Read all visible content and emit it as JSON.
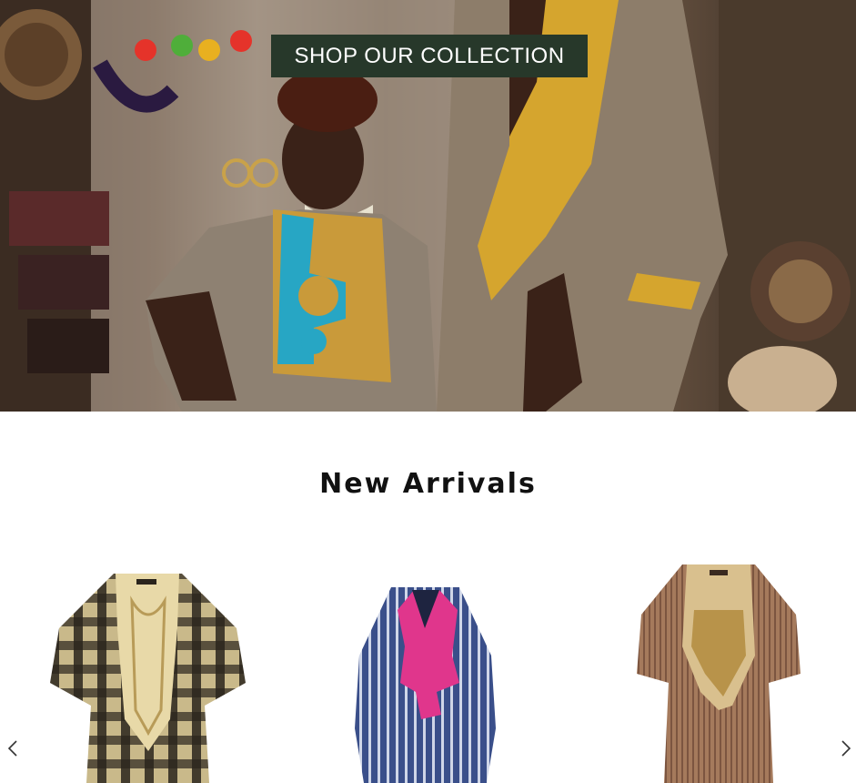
{
  "hero": {
    "cta_label": "SHOP OUR COLLECTION",
    "image_icon": "hero-photo-icon"
  },
  "new_arrivals": {
    "title": "New Arrivals",
    "products": [
      {
        "image_icon": "kaftan-plaid-icon",
        "colors": {
          "base": "#c9b98a",
          "stripe": "#2a241c",
          "panel": "#e8d9a8"
        }
      },
      {
        "image_icon": "kaftan-blue-icon",
        "colors": {
          "base": "#3a4f8a",
          "stripe": "#cfd6e8",
          "panel": "#e0368c"
        }
      },
      {
        "image_icon": "kaftan-brown-icon",
        "colors": {
          "base": "#a57a5c",
          "stripe": "#7c5540",
          "panel": "#d9c08e"
        }
      }
    ],
    "prev_icon": "chevron-left-icon",
    "next_icon": "chevron-right-icon"
  },
  "colors": {
    "cta_bg": "#27382a",
    "title": "#111111"
  }
}
